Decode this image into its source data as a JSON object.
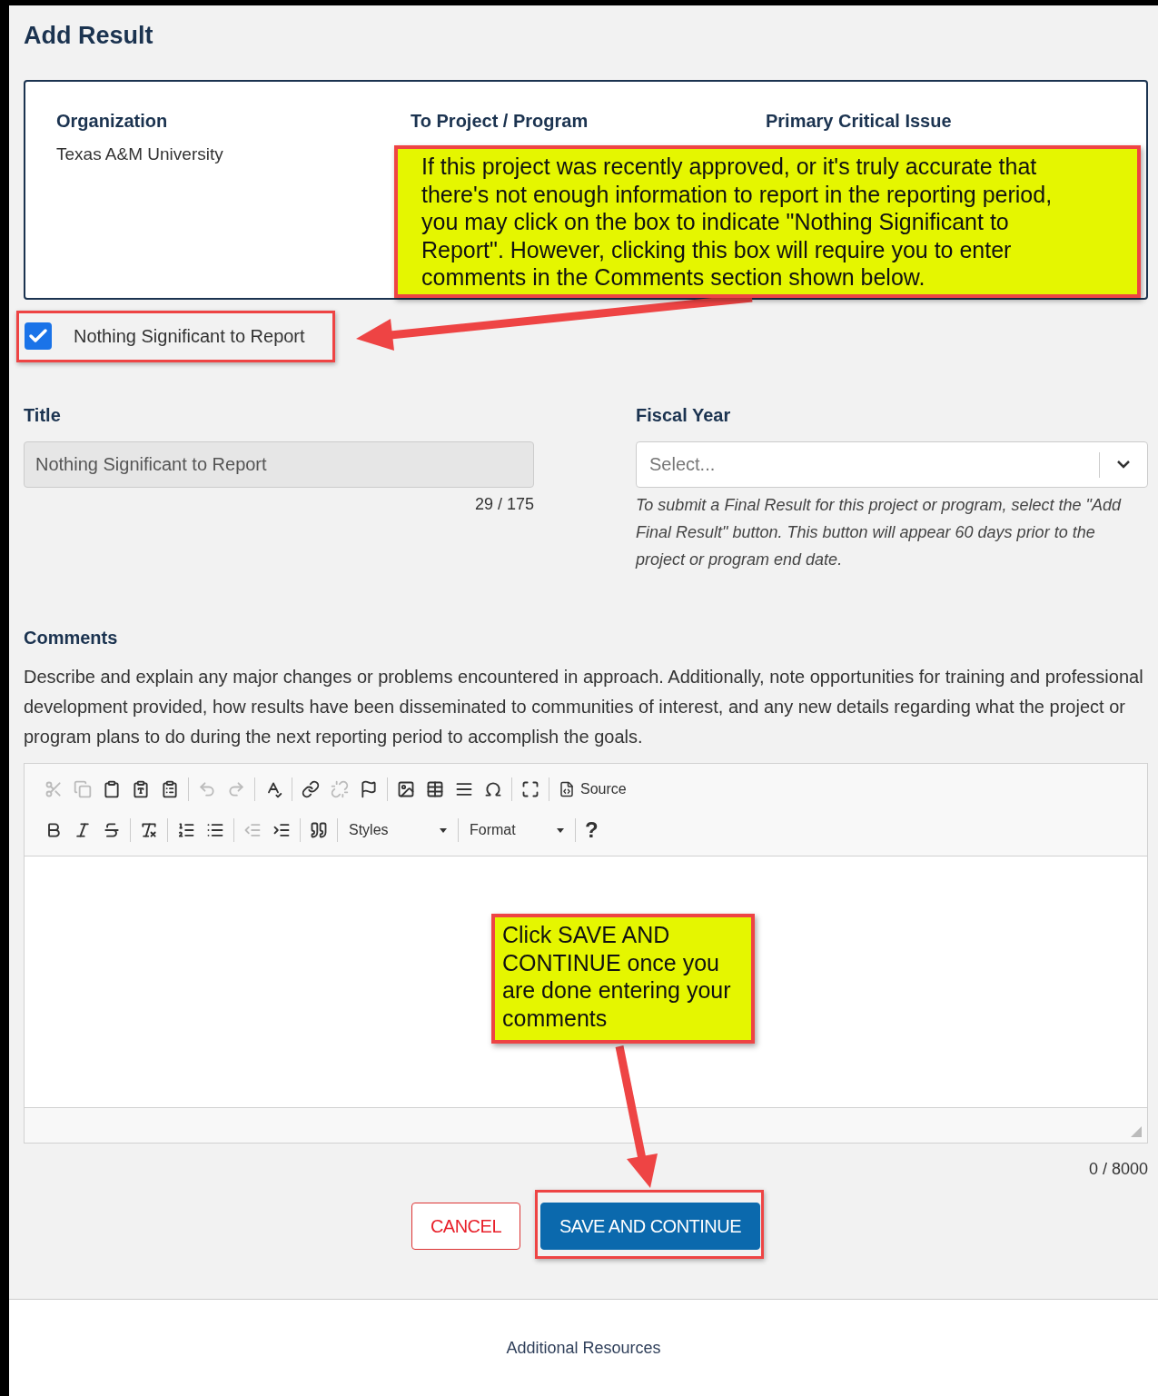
{
  "page": {
    "title": "Add Result"
  },
  "info_card": {
    "columns": [
      {
        "heading": "Organization",
        "value": "Texas A&M University"
      },
      {
        "heading": "To Project / Program"
      },
      {
        "heading": "Primary Critical Issue"
      }
    ]
  },
  "nothing_significant": {
    "label": "Nothing Significant to Report",
    "checked": true
  },
  "title_field": {
    "label": "Title",
    "value": "Nothing Significant to Report",
    "disabled": true,
    "counter": "29 / 175"
  },
  "fiscal_year": {
    "label": "Fiscal Year",
    "placeholder": "Select...",
    "hint": "To submit a Final Result for this project or program, select the \"Add Final Result\" button. This button will appear 60 days prior to the project or program end date."
  },
  "comments": {
    "label": "Comments",
    "description": "Describe and explain any major changes or problems encountered in approach. Additionally, note opportunities for training and professional development provided, how results have been disseminated to communities of interest, and any new details regarding what the project or program plans to do during the next reporting period to accomplish the goals.",
    "toolbar": {
      "row_1": [
        [
          {
            "kind": "icon",
            "disabled": true
          },
          {
            "kind": "icon",
            "disabled": true
          },
          {
            "kind": "icon",
            "disabled": false
          },
          {
            "kind": "icon",
            "disabled": false
          },
          {
            "kind": "icon",
            "disabled": false
          }
        ],
        [
          {
            "kind": "icon",
            "disabled": true
          },
          {
            "kind": "icon",
            "disabled": true
          }
        ],
        [
          {
            "kind": "icon",
            "disabled": false
          }
        ],
        [
          {
            "kind": "icon",
            "disabled": false
          },
          {
            "kind": "icon",
            "disabled": true
          },
          {
            "kind": "icon",
            "disabled": false
          }
        ],
        [
          {
            "kind": "icon",
            "disabled": false
          },
          {
            "kind": "icon",
            "disabled": false
          },
          {
            "kind": "icon",
            "disabled": false
          },
          {
            "kind": "icon",
            "disabled": false
          }
        ],
        [
          {
            "kind": "icon",
            "disabled": false
          }
        ],
        [
          {
            "kind": "icon_label",
            "label": "Source",
            "disabled": false
          }
        ]
      ],
      "row_2": [
        [
          {
            "kind": "icon",
            "disabled": false
          },
          {
            "kind": "icon",
            "disabled": false
          },
          {
            "kind": "icon",
            "disabled": false
          }
        ],
        [
          {
            "kind": "icon",
            "disabled": false
          }
        ],
        [
          {
            "kind": "icon",
            "disabled": false
          },
          {
            "kind": "icon",
            "disabled": false
          }
        ],
        [
          {
            "kind": "icon",
            "disabled": true
          },
          {
            "kind": "icon",
            "disabled": false
          }
        ],
        [
          {
            "kind": "icon",
            "disabled": false
          }
        ],
        [
          {
            "kind": "dropdown",
            "label": "Styles"
          }
        ],
        [
          {
            "kind": "dropdown",
            "label": "Format"
          }
        ],
        [
          {
            "kind": "text",
            "label": "?"
          }
        ]
      ]
    },
    "counter": "0 / 8000"
  },
  "buttons": [
    {
      "kind": "secondary",
      "label": "CANCEL"
    },
    {
      "kind": "primary",
      "label": "SAVE AND CONTINUE"
    }
  ],
  "footer": {
    "link": "Additional Resources"
  },
  "annotations": [
    {
      "text": "If this project was recently approved, or it's truly accurate that there's not enough information to report in the reporting period, you may click on the box to indicate \"Nothing Significant to Report\".  However, clicking this box will require you to enter comments in the Comments section shown below."
    },
    {
      "text": "Click SAVE AND CONTINUE once you are done entering your comments"
    }
  ]
}
